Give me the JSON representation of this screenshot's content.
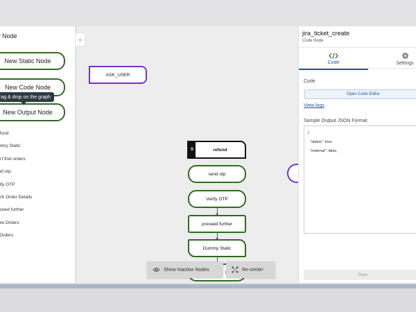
{
  "left_panel": {
    "title": "w Node",
    "buttons": {
      "static": "New Static Node",
      "code": "New Code Node",
      "output": "New Output Node"
    },
    "tooltip": "rag & drop on the graph",
    "node_list": [
      "refund",
      "ummy Static",
      "an't find orders",
      "end otp",
      "erify OTP",
      "etch Order Details",
      "roceed further",
      "how Orders",
      "o Orders"
    ]
  },
  "canvas": {
    "nodes": {
      "ask_user": "ASK_USER",
      "refund_badge": "S",
      "refund": "refund",
      "send_otp": "send otp",
      "verify_otp": "Verify OTP",
      "proceed_further": "proceed further",
      "dummy_static": "Dummy Static",
      "partial": "D"
    },
    "buttons": {
      "show_inactive": "Show Inactive Nodes",
      "recenter": "Re-center"
    }
  },
  "right_panel": {
    "title": "jira_ticket_create",
    "subtitle": "Code Node",
    "tabs": {
      "code": "Code",
      "settings": "Settings"
    },
    "code_label": "Code",
    "open_editor": "Open Code Editor",
    "view_logs": "View logs",
    "sample_label": "Sample Output JSON Format",
    "sample_json": [
      "{",
      "  \"status\": true,",
      "  \"external\": false,"
    ],
    "save": "Save"
  },
  "colors": {
    "green_border": "#2e6b1f",
    "purple_border": "#7a2ed0",
    "accent_blue": "#1f5a9e"
  },
  "icons": [
    "chevron-left-icon",
    "code-icon",
    "gear-icon",
    "eye-icon",
    "recenter-icon"
  ]
}
